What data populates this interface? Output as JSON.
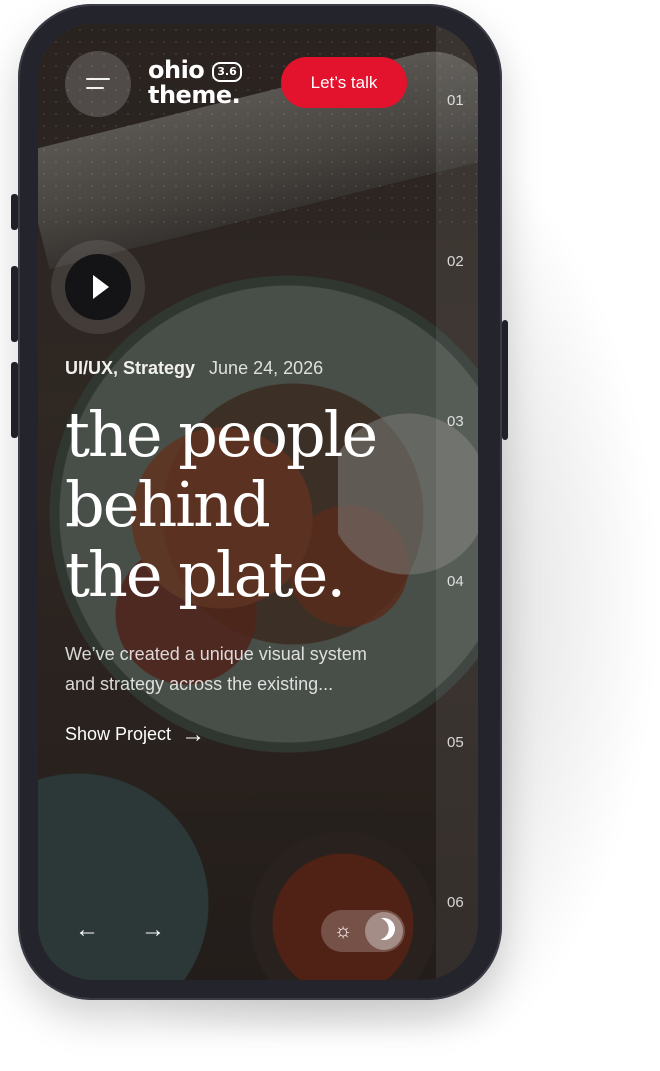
{
  "header": {
    "logo_line1": "ohio",
    "logo_version": "3.6",
    "logo_line2": "theme.",
    "cta_label": "Let’s talk"
  },
  "slider": {
    "numbers": [
      "01",
      "02",
      "03",
      "04",
      "05",
      "06"
    ]
  },
  "project": {
    "categories": "UI/UX, Strategy",
    "date": "June 24, 2026",
    "title_line1": "the people",
    "title_line2": "behind",
    "title_line3": "the plate.",
    "description": "We’ve created a unique visual system and strategy across the existing...",
    "link_label": "Show Project"
  },
  "icons": {
    "menu": "hamburger-icon",
    "play": "play-icon",
    "prev": "arrow-left-icon",
    "next": "arrow-right-icon",
    "light": "sun-icon",
    "dark": "moon-icon"
  },
  "colors": {
    "accent": "#e3122d",
    "phone_frame": "#24252c"
  }
}
